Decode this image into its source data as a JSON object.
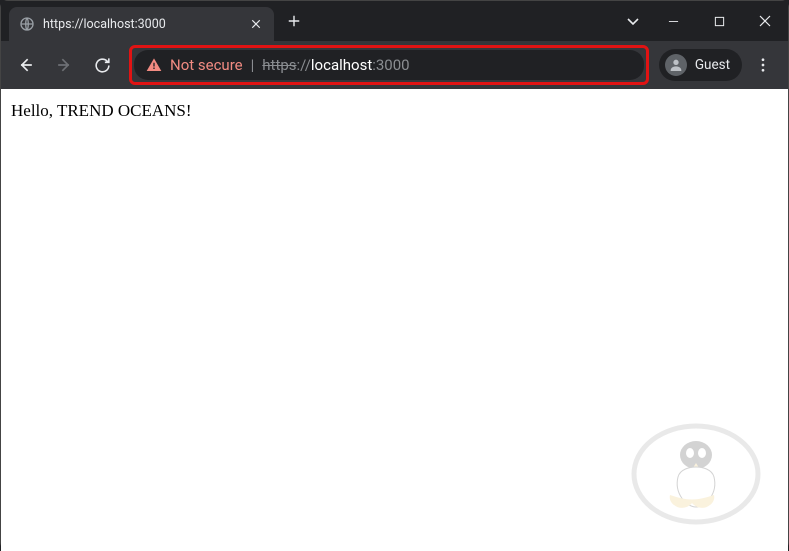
{
  "tab": {
    "title": "https://localhost:3000"
  },
  "security": {
    "label": "Not secure",
    "warning_icon": "warning-triangle-icon"
  },
  "url": {
    "scheme": "https",
    "separator": "://",
    "host": "localhost",
    "port": ":3000"
  },
  "profile": {
    "label": "Guest"
  },
  "page": {
    "body_text": "Hello, TREND OCEANS!"
  }
}
